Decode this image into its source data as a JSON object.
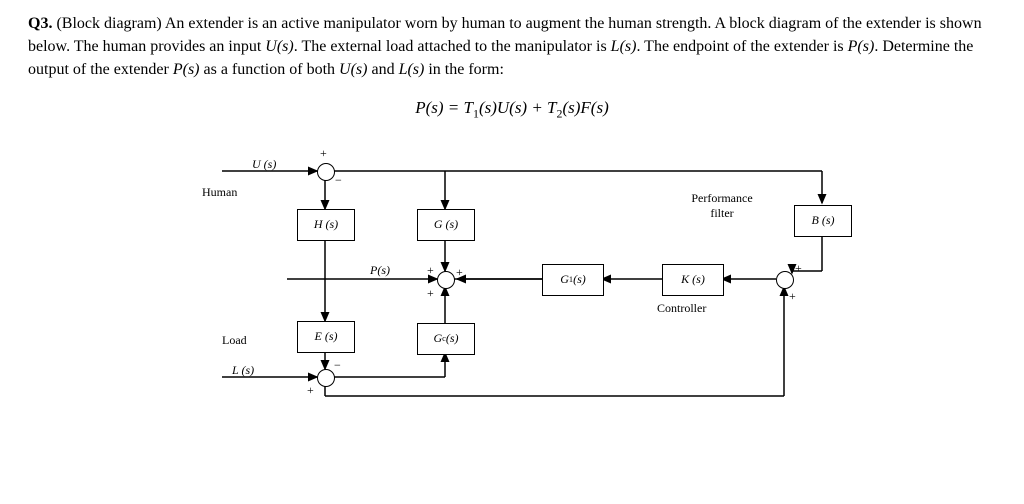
{
  "q": {
    "num": "Q3.",
    "title": "(Block diagram)",
    "text1": "An extender is an active manipulator worn by human to augment the human strength. A block diagram of the extender is shown below. The human provides an input ",
    "Us": "U(s)",
    "text2": ". The external load attached to the manipulator is ",
    "Ls": "L(s)",
    "text3": ". The endpoint of the extender is ",
    "Ps": "P(s)",
    "text4": ". Determine the output of the extender ",
    "text5": " as a function of both ",
    "and": " and ",
    "text6": " in the form:"
  },
  "eq": {
    "lhs": "P(s) = T",
    "sub1": "1",
    "mid1": "(s)U(s) + T",
    "sub2": "2",
    "mid2": "(s)F(s)"
  },
  "d": {
    "human": "Human",
    "load": "Load",
    "perf": "Performance",
    "filter": "filter",
    "controller": "Controller",
    "U": "U (s)",
    "L": "L (s)",
    "P": "P(s)",
    "H": "H (s)",
    "G": "G (s)",
    "E": "E (s)",
    "Gc": "G",
    "Gc_sub": "c",
    "Gc_tail": "(s)",
    "G1": "G",
    "G1_sub": "1",
    "G1_tail": "(s)",
    "K": "K (s)",
    "B": "B (s)",
    "plus": "+",
    "minus": "−"
  }
}
